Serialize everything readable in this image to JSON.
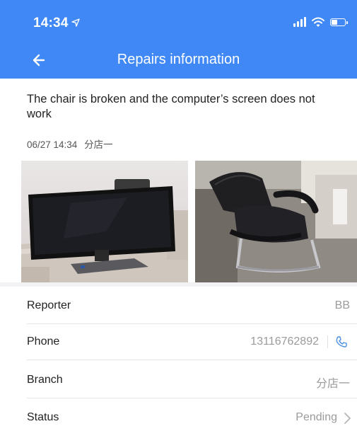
{
  "status_bar": {
    "time": "14:34",
    "location_icon": "location-arrow-icon",
    "icons": [
      "signal-icon",
      "wifi-icon",
      "battery-icon"
    ]
  },
  "navbar": {
    "title": "Repairs information",
    "back_icon": "back-arrow-icon",
    "background_color": "#3f88f5"
  },
  "repair": {
    "description": "The chair is broken and the computer’s screen does not work",
    "date": "06/27 14:34",
    "branch_tag": "分店一",
    "photos": [
      "monitor-photo",
      "office-chair-photo"
    ]
  },
  "details": {
    "reporter": {
      "label": "Reporter",
      "value": "BB"
    },
    "phone": {
      "label": "Phone",
      "value": "13116762892",
      "icon": "phone-icon"
    },
    "branch": {
      "label": "Branch",
      "value": "分店一"
    },
    "status": {
      "label": "Status",
      "value": "Pending",
      "icon": "chevron-right-icon"
    }
  },
  "colors": {
    "accent": "#3f88f5",
    "muted_text": "#9b9b9b"
  }
}
